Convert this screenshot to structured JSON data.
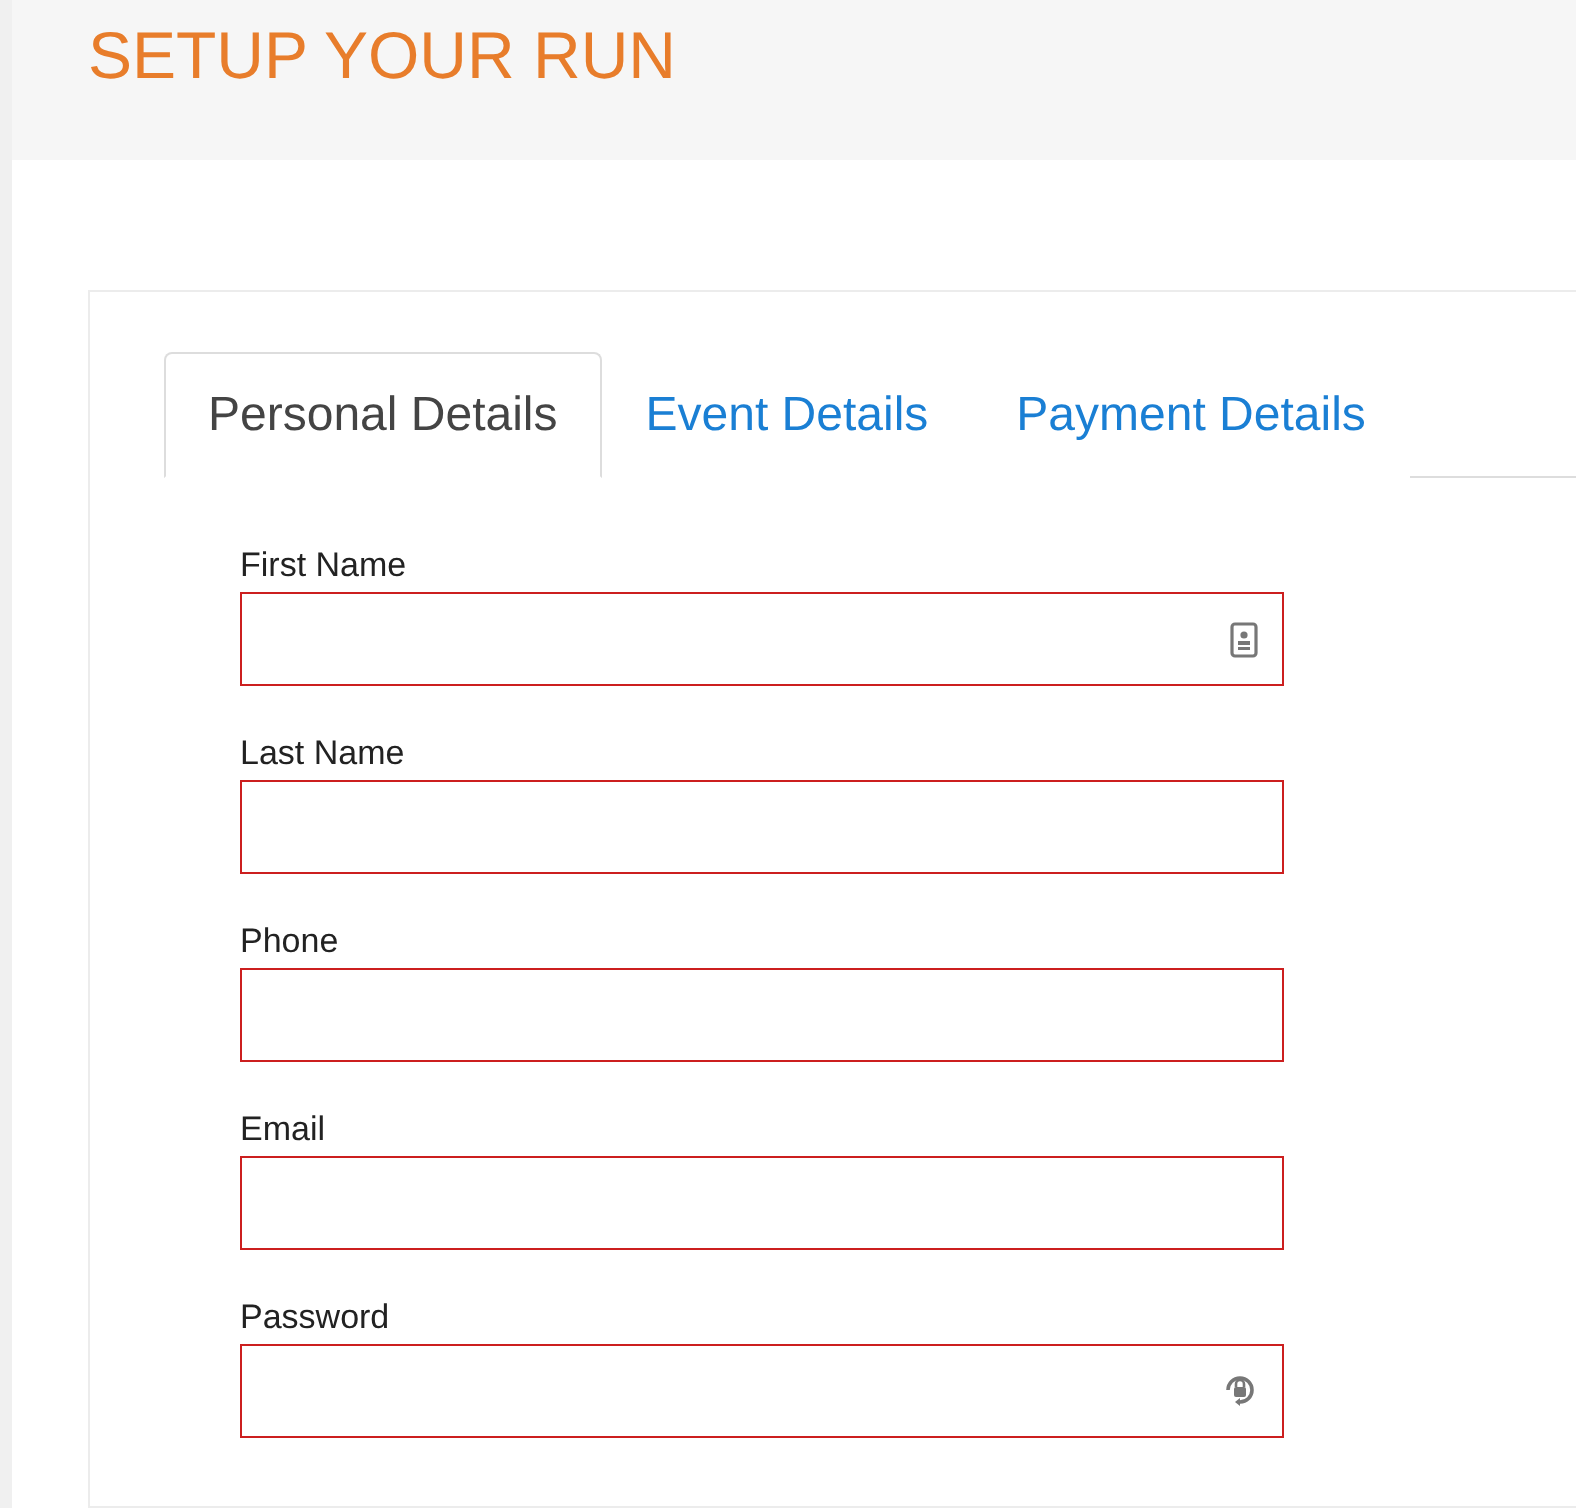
{
  "header": {
    "title": "SETUP YOUR RUN"
  },
  "tabs": [
    {
      "label": "Personal Details",
      "selected": true
    },
    {
      "label": "Event Details",
      "selected": false
    },
    {
      "label": "Payment Details",
      "selected": false
    }
  ],
  "fields": [
    {
      "label": "First Name",
      "kind": "contact",
      "invalid": true
    },
    {
      "label": "Last Name",
      "kind": "plain",
      "invalid": true
    },
    {
      "label": "Phone",
      "kind": "plain",
      "invalid": true
    },
    {
      "label": "Email",
      "kind": "plain",
      "invalid": true
    },
    {
      "label": "Password",
      "kind": "lock",
      "invalid": true
    }
  ]
}
